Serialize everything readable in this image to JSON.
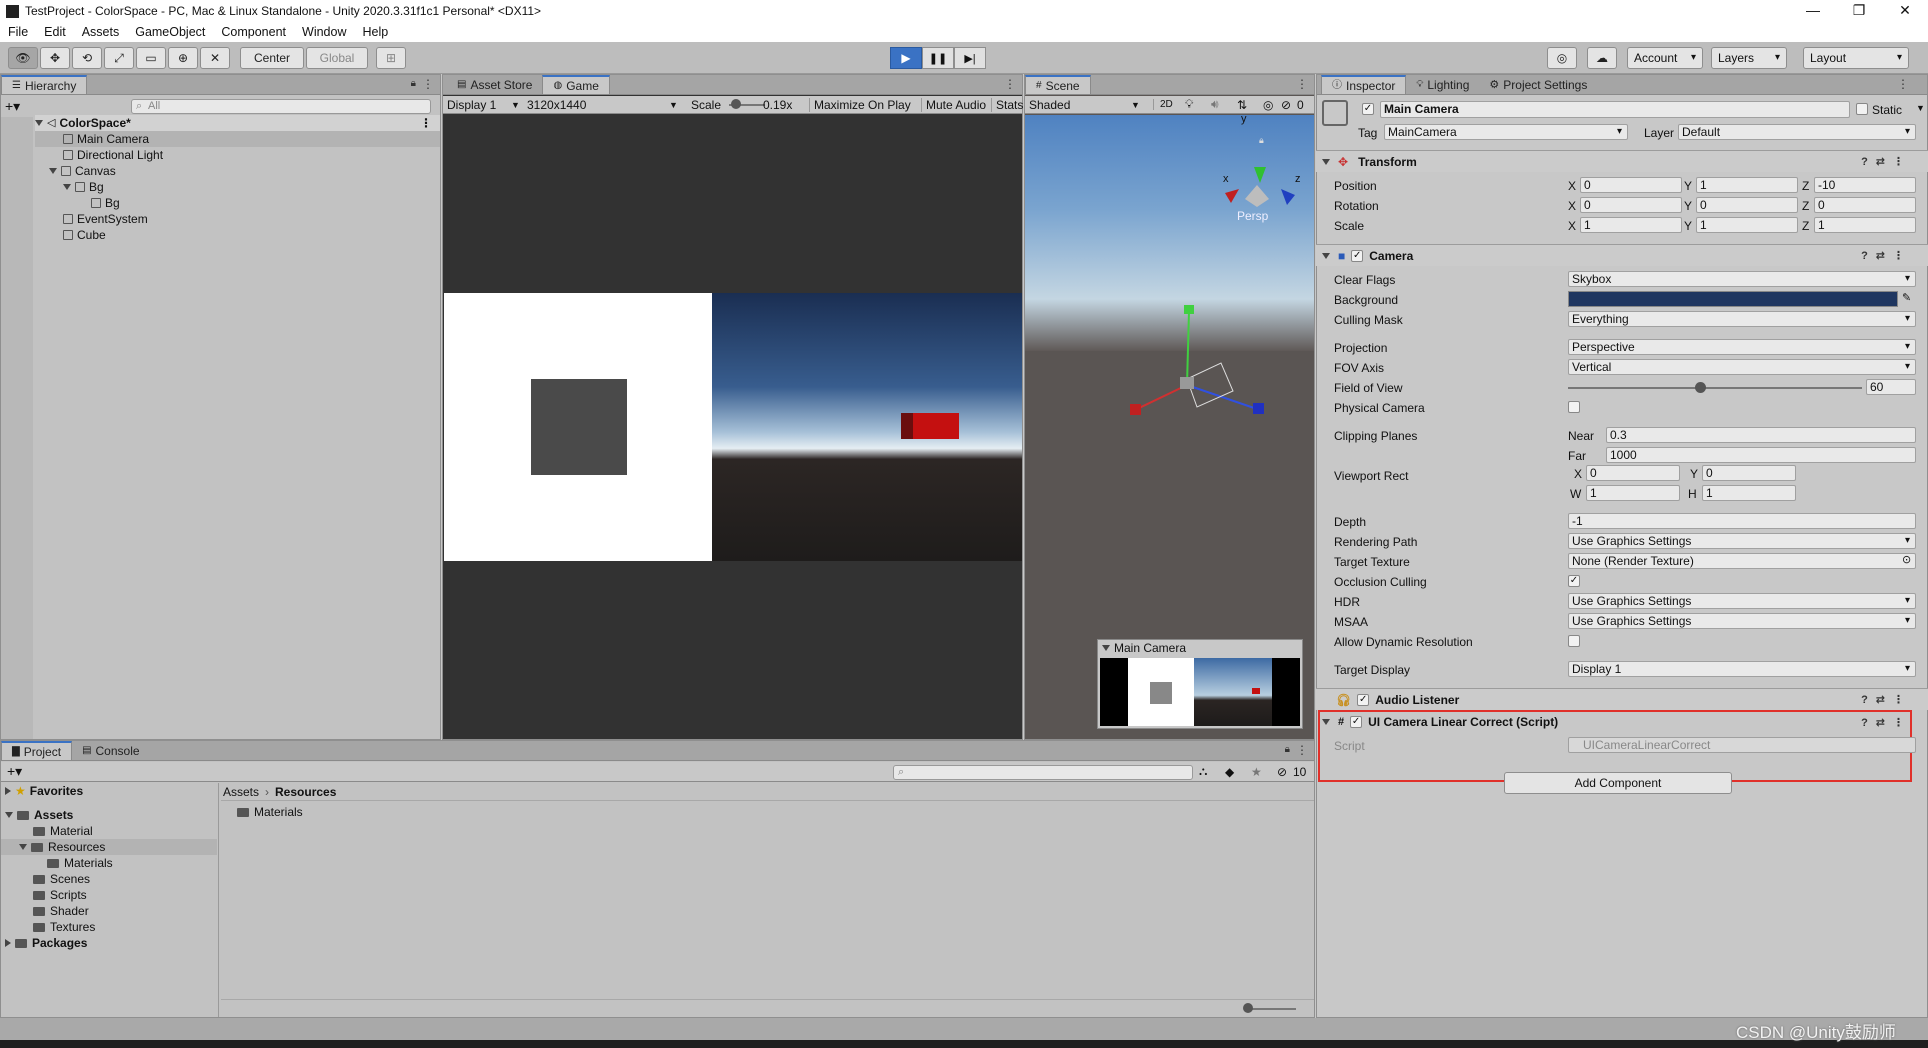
{
  "window": {
    "title": "TestProject - ColorSpace - PC, Mac & Linux Standalone - Unity 2020.3.31f1c1 Personal* <DX11>",
    "min": "—",
    "max": "❐",
    "close": "✕"
  },
  "menu": [
    "File",
    "Edit",
    "Assets",
    "GameObject",
    "Component",
    "Window",
    "Help"
  ],
  "toolbar": {
    "center": "Center",
    "global": "Global",
    "account": "Account",
    "layers": "Layers",
    "layout": "Layout"
  },
  "hierarchy": {
    "tab": "Hierarchy",
    "search": "All",
    "items": [
      "ColorSpace*",
      "Main Camera",
      "Directional Light",
      "Canvas",
      "Bg",
      "Bg",
      "EventSystem",
      "Cube"
    ]
  },
  "game": {
    "tab_store": "Asset Store",
    "tab_game": "Game",
    "display": "Display 1",
    "resolution": "3120x1440",
    "scale_label": "Scale",
    "scale_value": "0.19x",
    "maximize": "Maximize On Play",
    "mute": "Mute Audio",
    "stats": "Stats"
  },
  "scene": {
    "tab": "Scene",
    "shading": "Shaded",
    "mode2d": "2D",
    "hidden_count": "0",
    "persp": "Persp",
    "preview_title": "Main Camera",
    "gizmo_y": "y",
    "gizmo_x": "x",
    "gizmo_z": "z"
  },
  "inspector": {
    "tabs": [
      "Inspector",
      "Lighting",
      "Project Settings"
    ],
    "object_name": "Main Camera",
    "static": "Static",
    "tag_label": "Tag",
    "tag": "MainCamera",
    "layer_label": "Layer",
    "layer": "Default",
    "transform": {
      "title": "Transform",
      "position_label": "Position",
      "rotation_label": "Rotation",
      "scale_label": "Scale",
      "position": [
        "0",
        "1",
        "-10"
      ],
      "rotation": [
        "0",
        "0",
        "0"
      ],
      "scale": [
        "1",
        "1",
        "1"
      ],
      "x": "X",
      "y": "Y",
      "z": "Z"
    },
    "camera": {
      "title": "Camera",
      "clear_flags_label": "Clear Flags",
      "clear_flags": "Skybox",
      "background_label": "Background",
      "background_color": "#1f3660",
      "culling_label": "Culling Mask",
      "culling": "Everything",
      "projection_label": "Projection",
      "projection": "Perspective",
      "fov_axis_label": "FOV Axis",
      "fov_axis": "Vertical",
      "fov_label": "Field of View",
      "fov": "60",
      "fov_fraction": 0.45,
      "physical_label": "Physical Camera",
      "clipping_label": "Clipping Planes",
      "near_label": "Near",
      "near": "0.3",
      "far_label": "Far",
      "far": "1000",
      "viewport_label": "Viewport Rect",
      "vx_label": "X",
      "vx": "0",
      "vy_label": "Y",
      "vy": "0",
      "vw_label": "W",
      "vw": "1",
      "vh_label": "H",
      "vh": "1",
      "depth_label": "Depth",
      "depth": "-1",
      "rendering_label": "Rendering Path",
      "rendering": "Use Graphics Settings",
      "target_texture_label": "Target Texture",
      "target_texture": "None (Render Texture)",
      "occlusion_label": "Occlusion Culling",
      "hdr_label": "HDR",
      "hdr": "Use Graphics Settings",
      "msaa_label": "MSAA",
      "msaa": "Use Graphics Settings",
      "dynres_label": "Allow Dynamic Resolution",
      "target_display_label": "Target Display",
      "target_display": "Display 1"
    },
    "audio_listener": "Audio Listener",
    "script_comp": {
      "title": "UI Camera Linear Correct (Script)",
      "script_label": "Script",
      "script": "UICameraLinearCorrect"
    },
    "add_component": "Add Component"
  },
  "project": {
    "tabs": [
      "Project",
      "Console"
    ],
    "hidden_count": "10",
    "breadcrumb": [
      "Assets",
      "Resources"
    ],
    "tree": [
      "Favorites",
      "Assets",
      "Material",
      "Resources",
      "Materials",
      "Scenes",
      "Scripts",
      "Shader",
      "Textures",
      "Packages"
    ],
    "content": [
      "Materials"
    ]
  },
  "watermark": "CSDN @Unity鼓励师",
  "colors": {
    "accent": "#3a72c4",
    "highlight": "#e0302a"
  }
}
